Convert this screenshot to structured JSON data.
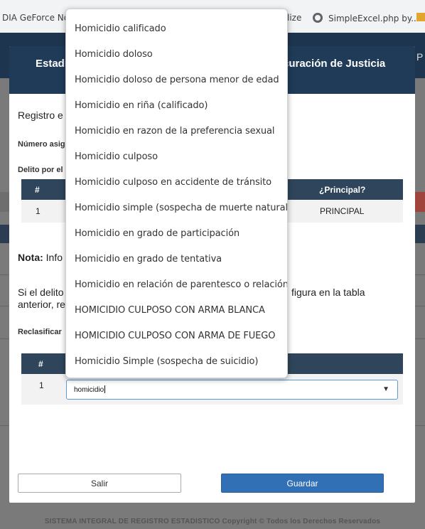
{
  "bookmarks": {
    "left_label": "DIA GeForce No...",
    "middle_label": "lize",
    "right_label": "SimpleExcel.php by..."
  },
  "modal": {
    "title_left": "Estadi",
    "title_right": "curación de Justicia",
    "registro_label": "Registro e",
    "numero_label": "Número asig",
    "delito_label": "Delito por el",
    "table1": {
      "col_num": "#",
      "col_principal": "¿Principal?",
      "row_num": "1",
      "row_principal": "PRINCIPAL"
    },
    "nota_label": "Nota:",
    "nota_text": "Info",
    "si_text_left": "Si el delito",
    "si_text_right": "figura en la tabla",
    "anterior_text": "anterior, re",
    "reclasificar_label": "Reclasificar",
    "table2": {
      "col_num": "#",
      "row_num": "1"
    },
    "combo": {
      "value": "homicidio",
      "arrow": "▼"
    },
    "buttons": {
      "salir": "Salir",
      "guardar": "Guardar"
    }
  },
  "footer": "SISTEMA INTEGRAL DE REGISTRO ESTADISTICO Copyright © Todos los Derechos Reservados",
  "dropdown_options": [
    "Homicidio calificado",
    "Homicidio doloso",
    "Homicidio doloso de persona menor de edad",
    "Homicidio en riña (calificado)",
    "Homicidio en razon de la preferencia sexual",
    "Homicidio culposo",
    "Homicidio culposo en accidente de tránsito",
    "Homicidio simple (sospecha de muerte natural)",
    "Homicidio en grado de participación",
    "Homicidio en grado de tentativa",
    "Homicidio en relación de parentesco o relación",
    "HOMICIDIO CULPOSO CON ARMA BLANCA",
    "HOMICIDIO CULPOSO CON ARMA DE FUEGO",
    "Homicidio Simple (sospecha de suicidio)"
  ]
}
